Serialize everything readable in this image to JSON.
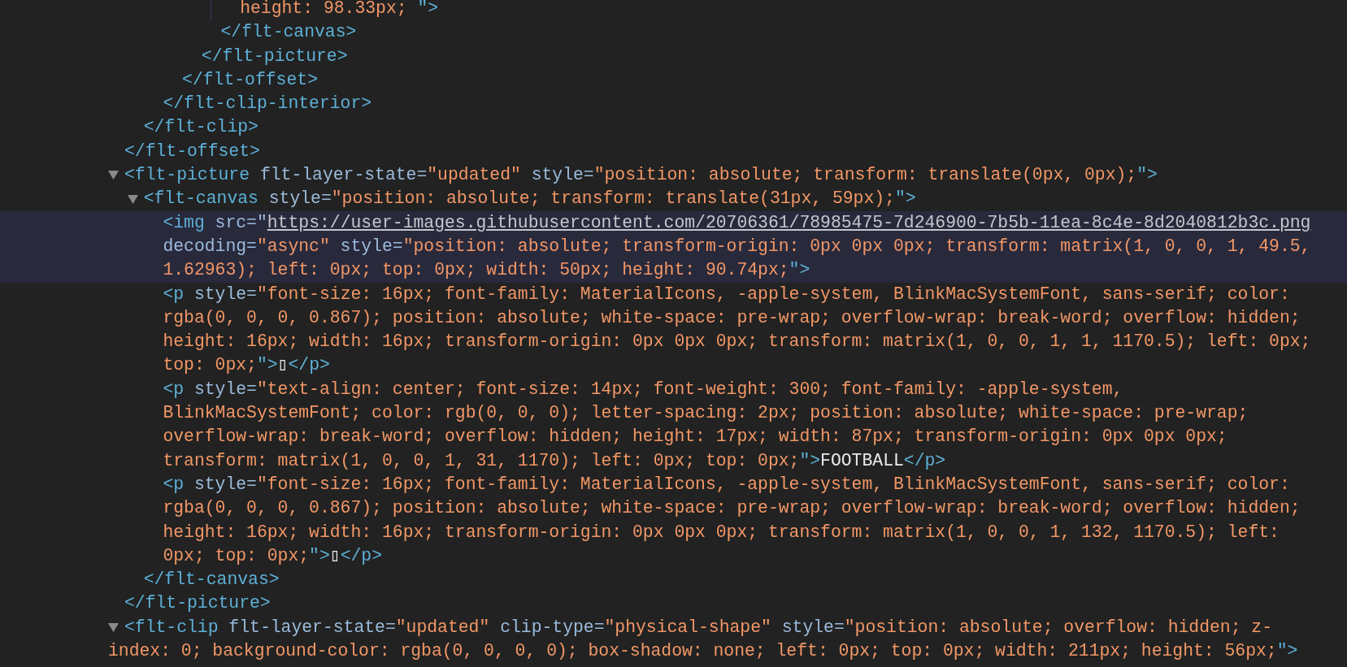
{
  "nodes": [
    {
      "selected": false,
      "closing": "</flt-offset>",
      "children": [
        {
          "selected": false,
          "closing": "</flt-clip>",
          "children": [
            {
              "selected": false,
              "closing": "</flt-clip-interior>",
              "children": [
                {
                  "selected": false,
                  "closing": "</flt-offset>",
                  "children": [
                    {
                      "selected": false,
                      "closing": "</flt-picture>",
                      "children": [
                        {
                          "selected": false,
                          "closing": "</flt-canvas>",
                          "guide": true,
                          "children": [
                            {
                              "selected": false,
                              "lines": [
                                [
                                  {
                                    "kind": "value",
                                    "text": "height: 98.33px; "
                                  },
                                  {
                                    "kind": "tag",
                                    "text": "\">"
                                  }
                                ]
                              ]
                            }
                          ]
                        }
                      ]
                    }
                  ]
                }
              ]
            }
          ]
        }
      ]
    },
    {
      "selected": false,
      "expanded": true,
      "closing": "</flt-picture>",
      "lines": [
        [
          {
            "kind": "tag",
            "text": "<flt-picture"
          },
          {
            "kind": "attr",
            "text": " flt-layer-state="
          },
          {
            "kind": "value",
            "text": "\"updated\""
          },
          {
            "kind": "attr",
            "text": " style="
          },
          {
            "kind": "value",
            "text": "\"position: absolute; transform: translate(0px, 0px);"
          },
          {
            "kind": "tag",
            "text": "\">"
          }
        ]
      ],
      "children": [
        {
          "selected": false,
          "expanded": true,
          "closing": "</flt-canvas>",
          "lines": [
            [
              {
                "kind": "tag",
                "text": "<flt-canvas"
              },
              {
                "kind": "attr",
                "text": " style="
              },
              {
                "kind": "value",
                "text": "\"position: absolute; transform: translate(31px, 59px);"
              },
              {
                "kind": "tag",
                "text": "\">"
              }
            ]
          ],
          "children": [
            {
              "selected": true,
              "lines": [
                [
                  {
                    "kind": "tag",
                    "text": "<img"
                  },
                  {
                    "kind": "attr",
                    "text": " src=\""
                  },
                  {
                    "kind": "url",
                    "text": "https://user-images.githubusercontent.com/20706361/78985475-7d246900-7b5b-11ea-8c4e-8d2040812b3c.png"
                  }
                ],
                [
                  {
                    "kind": "attr",
                    "text": "decoding="
                  },
                  {
                    "kind": "value",
                    "text": "\"async\""
                  },
                  {
                    "kind": "attr",
                    "text": " style="
                  },
                  {
                    "kind": "value",
                    "text": "\"position: absolute; transform-origin: 0px 0px 0px; transform: matrix(1, 0, 0, 1, 49.5,"
                  }
                ],
                [
                  {
                    "kind": "value",
                    "text": "1.62963); left: 0px; top: 0px; width: 50px; height: 90.74px;"
                  },
                  {
                    "kind": "tag",
                    "text": "\">"
                  }
                ]
              ]
            },
            {
              "selected": false,
              "lines": [
                [
                  {
                    "kind": "tag",
                    "text": "<p"
                  },
                  {
                    "kind": "attr",
                    "text": " style="
                  },
                  {
                    "kind": "value",
                    "text": "\"font-size: 16px; font-family: MaterialIcons, -apple-system, BlinkMacSystemFont, sans-serif; color:"
                  }
                ],
                [
                  {
                    "kind": "value",
                    "text": "rgba(0, 0, 0, 0.867); position: absolute; white-space: pre-wrap; overflow-wrap: break-word; overflow: hidden;"
                  }
                ],
                [
                  {
                    "kind": "value",
                    "text": "height: 16px; width: 16px; transform-origin: 0px 0px 0px; transform: matrix(1, 0, 0, 1, 1, 1170.5); left: 0px;"
                  }
                ],
                [
                  {
                    "kind": "value",
                    "text": "top: 0px;"
                  },
                  {
                    "kind": "tag",
                    "text": "\">"
                  },
                  {
                    "kind": "plain",
                    "text": "▯"
                  },
                  {
                    "kind": "tag",
                    "text": "</p>"
                  }
                ]
              ]
            },
            {
              "selected": false,
              "lines": [
                [
                  {
                    "kind": "tag",
                    "text": "<p"
                  },
                  {
                    "kind": "attr",
                    "text": " style="
                  },
                  {
                    "kind": "value",
                    "text": "\"text-align: center; font-size: 14px; font-weight: 300; font-family: -apple-system,"
                  }
                ],
                [
                  {
                    "kind": "value",
                    "text": "BlinkMacSystemFont; color: rgb(0, 0, 0); letter-spacing: 2px; position: absolute; white-space: pre-wrap;"
                  }
                ],
                [
                  {
                    "kind": "value",
                    "text": "overflow-wrap: break-word; overflow: hidden; height: 17px; width: 87px; transform-origin: 0px 0px 0px;"
                  }
                ],
                [
                  {
                    "kind": "value",
                    "text": "transform: matrix(1, 0, 0, 1, 31, 1170); left: 0px; top: 0px;"
                  },
                  {
                    "kind": "tag",
                    "text": "\">"
                  },
                  {
                    "kind": "plain",
                    "text": "FOOTBALL"
                  },
                  {
                    "kind": "tag",
                    "text": "</p>"
                  }
                ]
              ]
            },
            {
              "selected": false,
              "lines": [
                [
                  {
                    "kind": "tag",
                    "text": "<p"
                  },
                  {
                    "kind": "attr",
                    "text": " style="
                  },
                  {
                    "kind": "value",
                    "text": "\"font-size: 16px; font-family: MaterialIcons, -apple-system, BlinkMacSystemFont, sans-serif; color:"
                  }
                ],
                [
                  {
                    "kind": "value",
                    "text": "rgba(0, 0, 0, 0.867); position: absolute; white-space: pre-wrap; overflow-wrap: break-word; overflow: hidden;"
                  }
                ],
                [
                  {
                    "kind": "value",
                    "text": "height: 16px; width: 16px; transform-origin: 0px 0px 0px; transform: matrix(1, 0, 0, 1, 132, 1170.5); left:"
                  }
                ],
                [
                  {
                    "kind": "value",
                    "text": "0px; top: 0px;"
                  },
                  {
                    "kind": "tag",
                    "text": "\">"
                  },
                  {
                    "kind": "plain",
                    "text": "▯"
                  },
                  {
                    "kind": "tag",
                    "text": "</p>"
                  }
                ]
              ]
            }
          ]
        }
      ]
    },
    {
      "selected": false,
      "expanded": true,
      "lines": [
        [
          {
            "kind": "tag",
            "text": "<flt-clip"
          },
          {
            "kind": "attr",
            "text": " flt-layer-state="
          },
          {
            "kind": "value",
            "text": "\"updated\""
          },
          {
            "kind": "attr",
            "text": " clip-type="
          },
          {
            "kind": "value",
            "text": "\"physical-shape\""
          },
          {
            "kind": "attr",
            "text": " style="
          },
          {
            "kind": "value",
            "text": "\"position: absolute; overflow: hidden; z-"
          }
        ],
        [
          {
            "kind": "value",
            "text": "index: 0; background-color: rgba(0, 0, 0, 0); box-shadow: none; left: 0px; top: 0px; width: 211px; height: 56px;"
          },
          {
            "kind": "tag",
            "text": "\">"
          }
        ]
      ]
    }
  ]
}
